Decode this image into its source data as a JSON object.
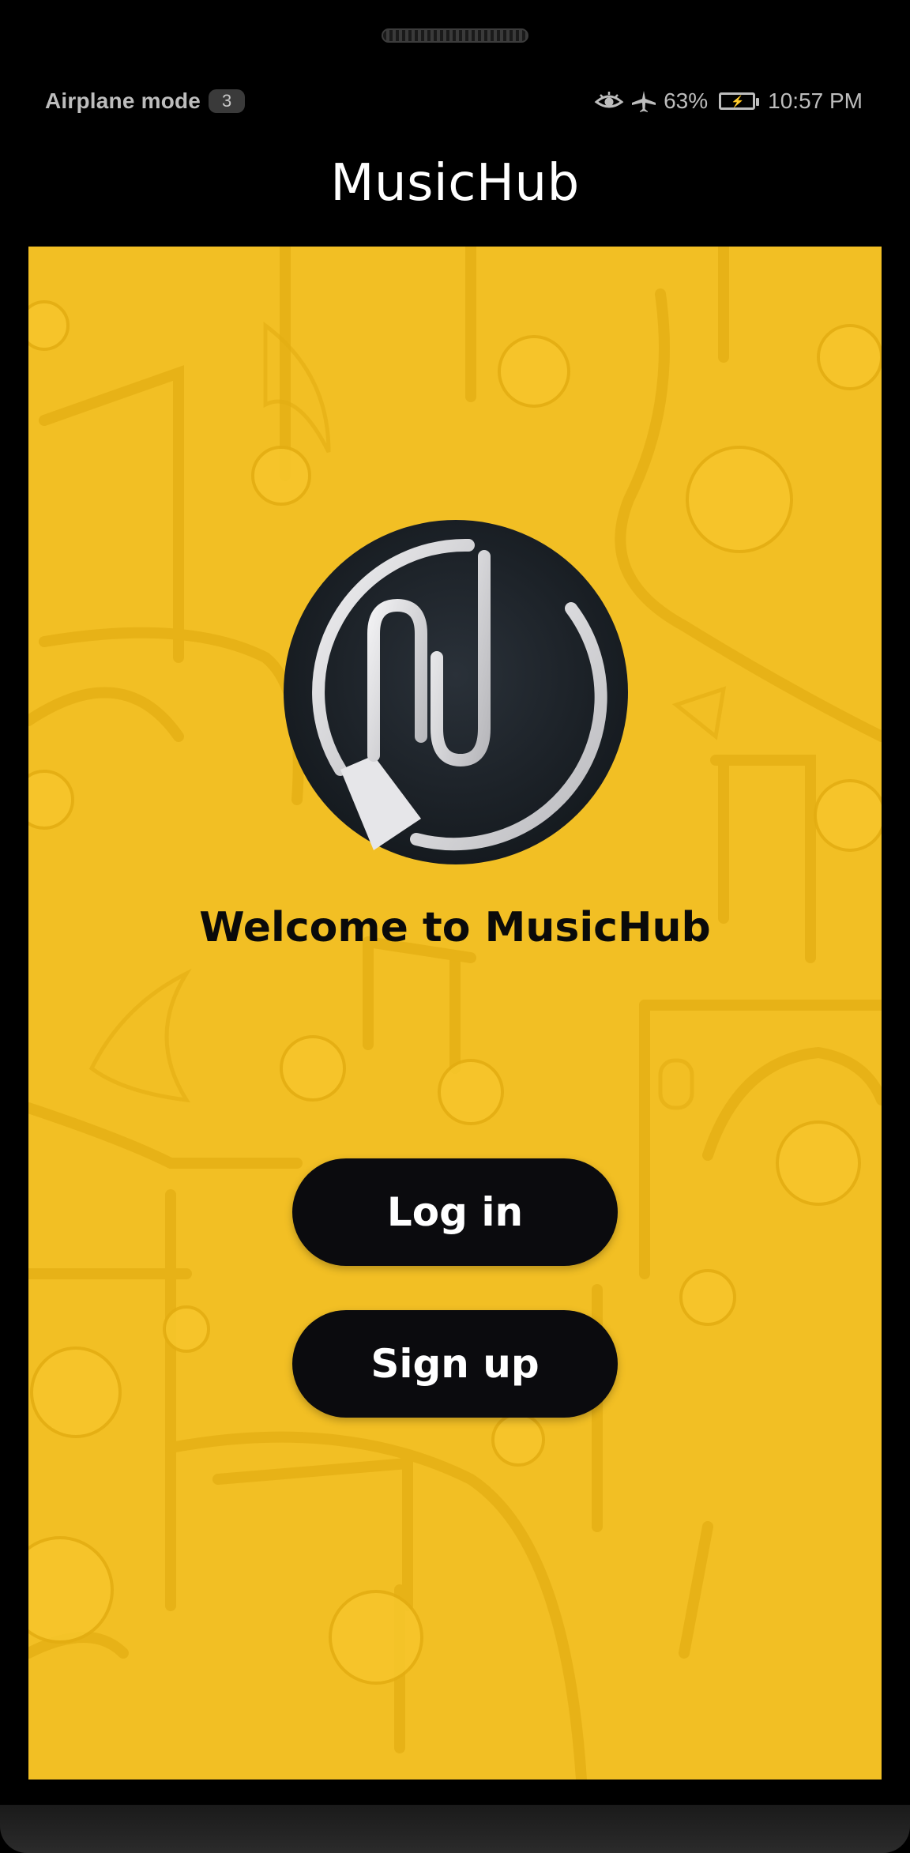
{
  "status_bar": {
    "mode_label": "Airplane mode",
    "mode_badge": "3",
    "battery_percent": "63%",
    "time": "10:57 PM",
    "icons": [
      "eye-icon",
      "airplane-icon",
      "battery-charging-icon"
    ]
  },
  "app": {
    "title": "MusicHub"
  },
  "main": {
    "welcome_text": "Welcome to MusicHub",
    "login_label": "Log in",
    "signup_label": "Sign up"
  },
  "colors": {
    "background_accent": "#f2bf24",
    "button": "#0b0b0e",
    "button_text": "#ffffff",
    "logo_dark": "#1e242b",
    "logo_ring": "#d9d9dc"
  }
}
